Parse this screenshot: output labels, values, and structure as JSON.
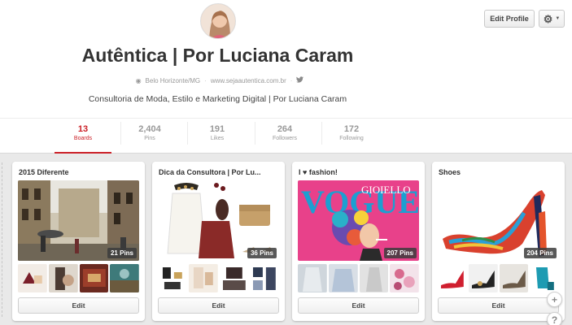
{
  "header": {
    "edit_profile_label": "Edit Profile"
  },
  "profile": {
    "name": "Autêntica | Por Luciana Caram",
    "location": "Belo Horizonte/MG",
    "website": "www.sejaautentica.com.br",
    "description": "Consultoria de Moda, Estilo e Marketing Digital | Por Luciana Caram"
  },
  "stats": [
    {
      "value": "13",
      "label": "Boards"
    },
    {
      "value": "2,404",
      "label": "Pins"
    },
    {
      "value": "191",
      "label": "Likes"
    },
    {
      "value": "264",
      "label": "Followers"
    },
    {
      "value": "172",
      "label": "Following"
    }
  ],
  "boards": [
    {
      "title": "2015 Diferente",
      "pins": "21 Pins",
      "edit_label": "Edit"
    },
    {
      "title": "Dica da Consultora | Por Lu...",
      "pins": "36 Pins",
      "edit_label": "Edit"
    },
    {
      "title": "I ♥ fashion!",
      "pins": "207 Pins",
      "edit_label": "Edit",
      "cover_text": "VOGUE",
      "cover_text2": "GIOIELLO"
    },
    {
      "title": "Shoes",
      "pins": "204 Pins",
      "edit_label": "Edit"
    }
  ],
  "floating": {
    "add_symbol": "+",
    "help_symbol": "?"
  },
  "colors": {
    "accent": "#cb2027",
    "page_bg": "#e9e9e9"
  }
}
